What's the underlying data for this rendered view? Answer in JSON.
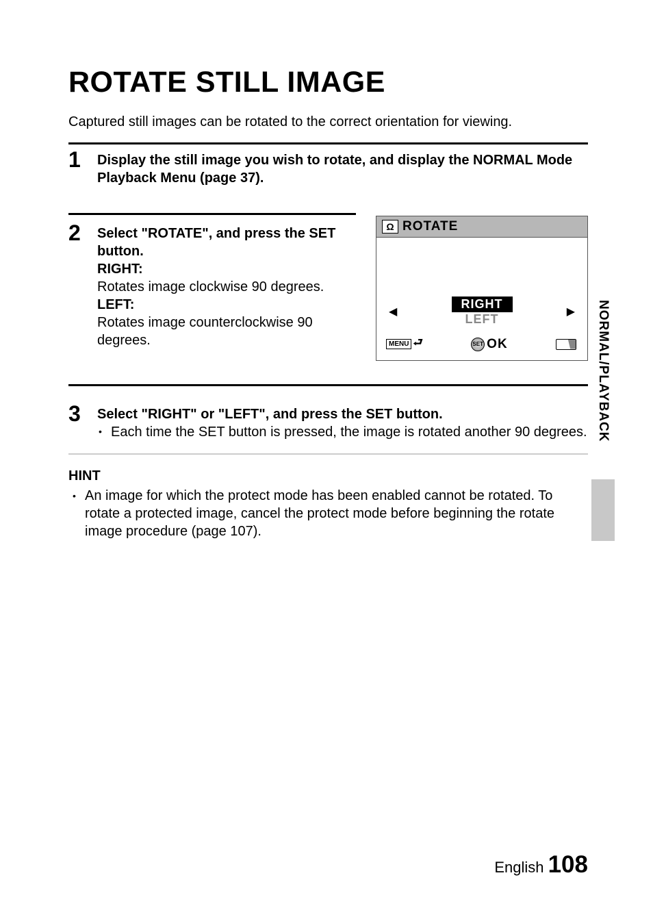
{
  "title": "ROTATE STILL IMAGE",
  "intro": "Captured still images can be rotated to the correct orientation for viewing.",
  "steps": {
    "s1": {
      "num": "1",
      "text": "Display the still image you wish to rotate, and display the NORMAL Mode Playback Menu (page 37)."
    },
    "s2": {
      "num": "2",
      "lead": "Select \"ROTATE\", and press the SET button.",
      "right_label": "RIGHT:",
      "right_desc": "Rotates image clockwise 90 degrees.",
      "left_label": "LEFT:",
      "left_desc": "Rotates image counterclockwise 90 degrees."
    },
    "s3": {
      "num": "3",
      "lead": "Select \"RIGHT\" or \"LEFT\", and press the SET button.",
      "bullet": "Each time the SET button is pressed, the image is rotated another 90 degrees."
    }
  },
  "hint": {
    "title": "HINT",
    "text": "An image for which the protect mode has been enabled cannot be rotated. To rotate a protected image, cancel the protect mode before beginning the rotate image procedure (page 107)."
  },
  "screen": {
    "header_icon": "Ω",
    "header_text": "ROTATE",
    "opt_right": "RIGHT",
    "opt_left": "LEFT",
    "menu": "MENU",
    "set": "SET",
    "ok": "OK"
  },
  "side_tab": "NORMAL/PLAYBACK",
  "footer": {
    "lang": "English",
    "page": "108"
  }
}
